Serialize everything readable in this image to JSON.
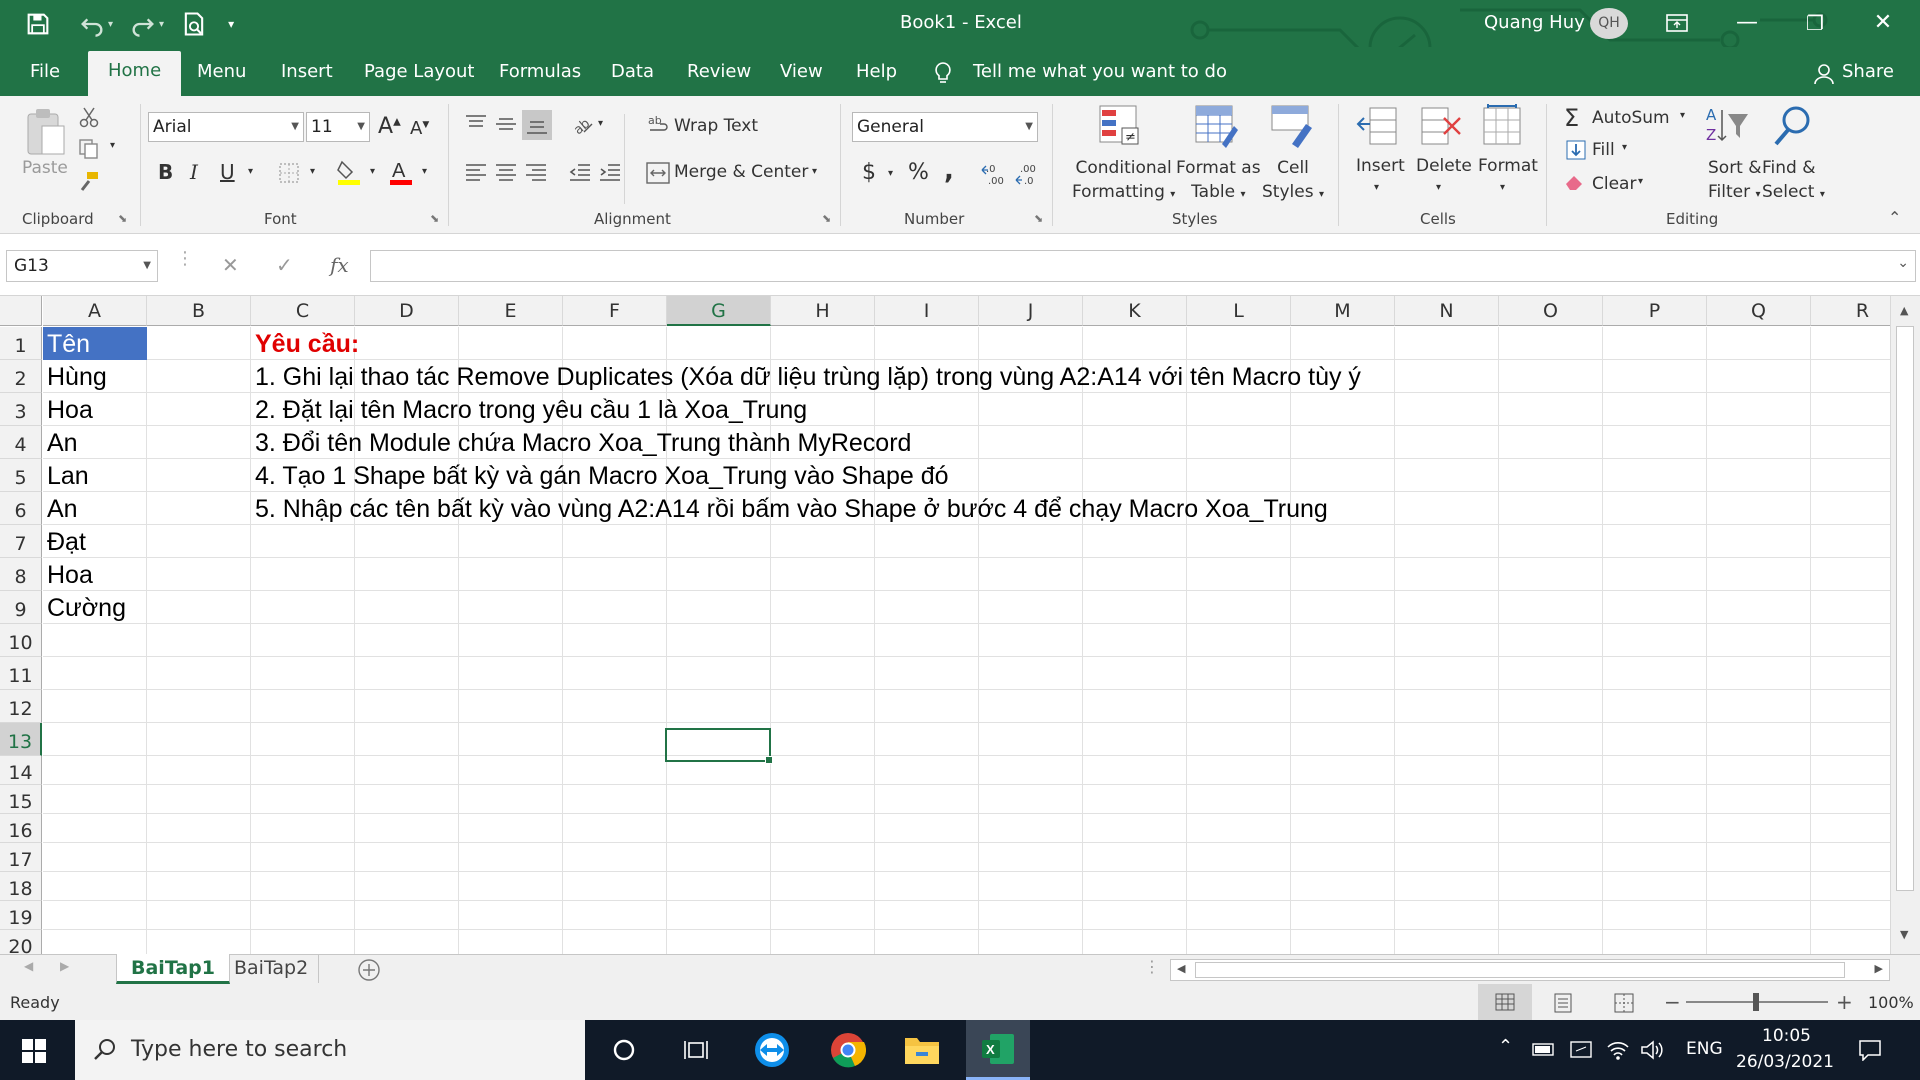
{
  "window": {
    "title": "Book1  -  Excel",
    "user_name": "Quang Huy",
    "user_initials": "QH",
    "minimize": "—",
    "restore": "❐",
    "close": "✕"
  },
  "tabs": [
    "File",
    "Home",
    "Menu",
    "Insert",
    "Page Layout",
    "Formulas",
    "Data",
    "Review",
    "View",
    "Help"
  ],
  "active_tab": "Home",
  "tell_me": "Tell me what you want to do",
  "share": "Share",
  "ribbon": {
    "clipboard": {
      "label": "Clipboard",
      "paste": "Paste"
    },
    "font": {
      "label": "Font",
      "name": "Arial",
      "size": "11",
      "bold": "B",
      "italic": "I",
      "underline": "U",
      "grow": "A",
      "shrink": "A"
    },
    "alignment": {
      "label": "Alignment",
      "wrap_text": "Wrap Text",
      "merge_center": "Merge & Center"
    },
    "number": {
      "label": "Number",
      "format": "General",
      "currency": "$",
      "percent": "%",
      "comma": ","
    },
    "styles": {
      "label": "Styles",
      "conditional": [
        "Conditional",
        "Formatting"
      ],
      "format_table": [
        "Format as",
        "Table"
      ],
      "cell_styles": [
        "Cell",
        "Styles"
      ]
    },
    "cells": {
      "label": "Cells",
      "insert": "Insert",
      "delete": "Delete",
      "format": "Format"
    },
    "editing": {
      "label": "Editing",
      "autosum": "AutoSum",
      "fill": "Fill",
      "clear": "Clear",
      "sort": [
        "Sort &",
        "Filter"
      ],
      "find": [
        "Find &",
        "Select"
      ]
    }
  },
  "formula_bar": {
    "name_box": "G13",
    "fx": "fx",
    "value": ""
  },
  "columns": [
    "A",
    "B",
    "C",
    "D",
    "E",
    "F",
    "G",
    "H",
    "I",
    "J",
    "K",
    "L",
    "M",
    "N",
    "O",
    "P",
    "Q",
    "R"
  ],
  "selected_column": "G",
  "rows": [
    "1",
    "2",
    "3",
    "4",
    "5",
    "6",
    "7",
    "8",
    "9",
    "10",
    "11",
    "12",
    "13",
    "14",
    "15",
    "16",
    "17",
    "18",
    "19",
    "20"
  ],
  "selected_row": "13",
  "cells": {
    "A": [
      "Tên",
      "Hùng",
      "Hoa",
      "An",
      "Lan",
      "An",
      "Đạt",
      "Hoa",
      "Cường"
    ],
    "C1": "Yêu cầu:",
    "C": [
      "1. Ghi lại thao tác Remove Duplicates (Xóa dữ liệu trùng lặp) trong vùng A2:A14 với tên Macro tùy ý",
      "2. Đặt lại tên Macro trong yêu cầu 1 là Xoa_Trung",
      "3. Đổi tên Module chứa Macro Xoa_Trung thành MyRecord",
      "4. Tạo 1 Shape bất kỳ và gán Macro Xoa_Trung vào Shape đó",
      "5. Nhập các tên bất kỳ vào vùng A2:A14 rồi bấm vào Shape ở bước 4 để chạy Macro Xoa_Trung"
    ]
  },
  "sheets": [
    "BaiTap1",
    "BaiTap2"
  ],
  "active_sheet": "BaiTap1",
  "status": {
    "text": "Ready",
    "zoom": "100%"
  },
  "taskbar": {
    "search_placeholder": "Type here to search",
    "lang": "ENG",
    "time": "10:05",
    "date": "26/03/2021"
  },
  "colors": {
    "excel_green": "#217346",
    "header_fill": "#4472c4",
    "red_text": "#e00000"
  }
}
